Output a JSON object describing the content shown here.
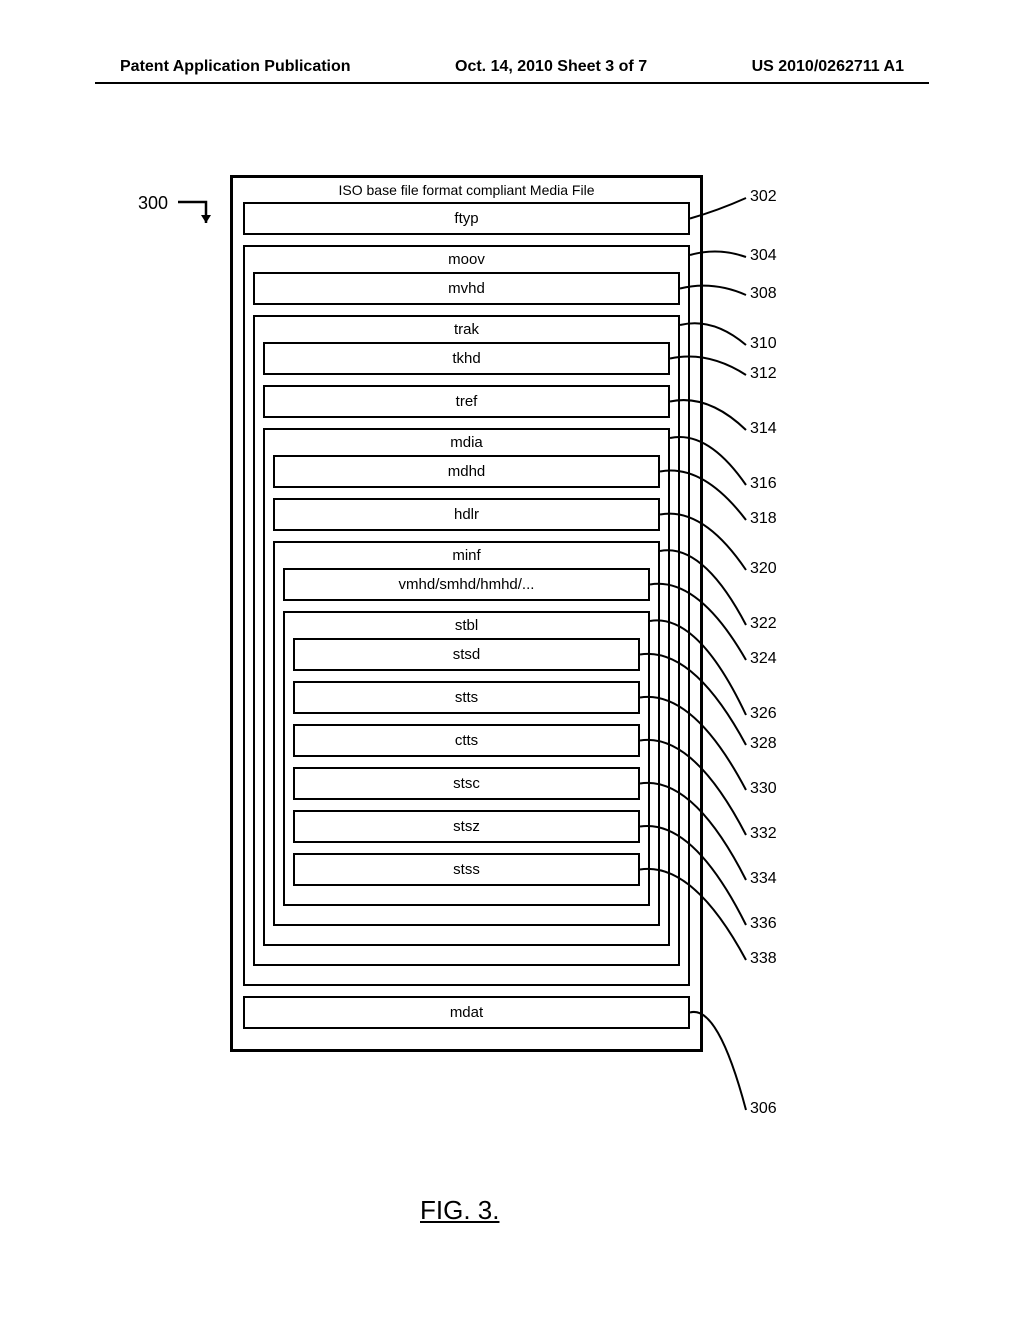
{
  "header": {
    "left": "Patent Application Publication",
    "center": "Oct. 14, 2010  Sheet 3 of 7",
    "right": "US 2010/0262711 A1"
  },
  "diagram": {
    "root_label": "300",
    "title": "ISO base file format compliant Media File",
    "caption": "FIG. 3.",
    "boxes": {
      "ftyp": "ftyp",
      "moov": "moov",
      "mvhd": "mvhd",
      "trak": "trak",
      "tkhd": "tkhd",
      "tref": "tref",
      "mdia": "mdia",
      "mdhd": "mdhd",
      "hdlr": "hdlr",
      "minf": "minf",
      "vmhd": "vmhd/smhd/hmhd/...",
      "stbl": "stbl",
      "stsd": "stsd",
      "stts": "stts",
      "ctts": "ctts",
      "stsc": "stsc",
      "stsz": "stsz",
      "stss": "stss",
      "mdat": "mdat"
    },
    "refs": {
      "r302": "302",
      "r304": "304",
      "r308": "308",
      "r310": "310",
      "r312": "312",
      "r314": "314",
      "r316": "316",
      "r318": "318",
      "r320": "320",
      "r322": "322",
      "r324": "324",
      "r326": "326",
      "r328": "328",
      "r330": "330",
      "r332": "332",
      "r334": "334",
      "r336": "336",
      "r338": "338",
      "r306": "306"
    }
  }
}
